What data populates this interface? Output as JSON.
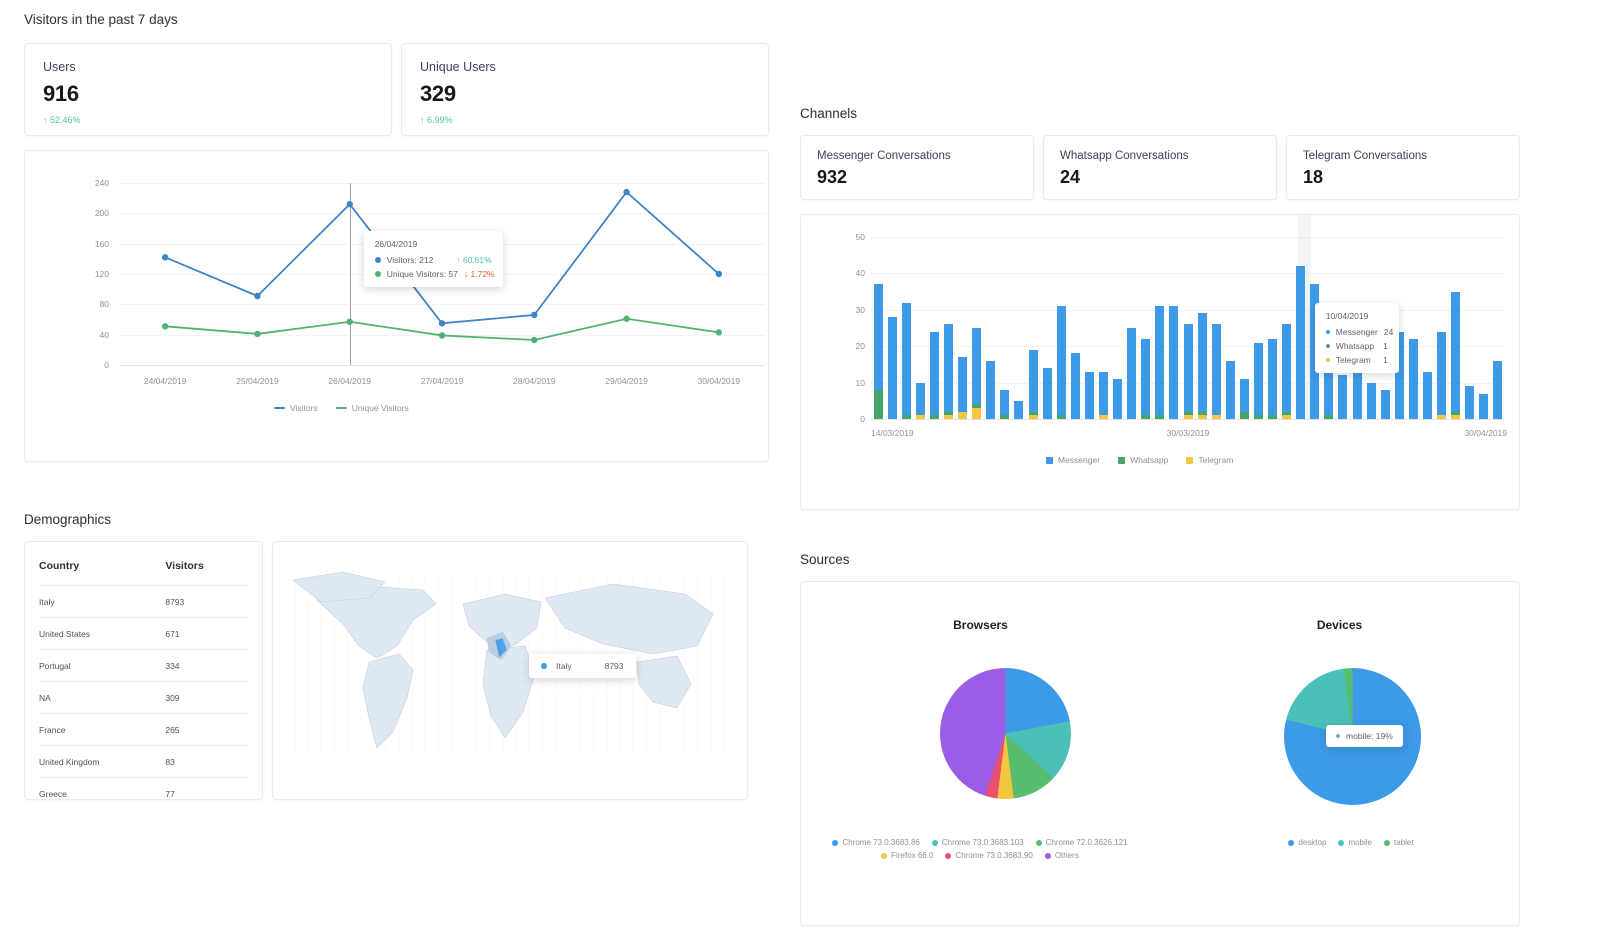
{
  "visitors": {
    "section_title": "Visitors in the past 7 days",
    "kpis": [
      {
        "label": "Users",
        "value": "916",
        "delta": "52.46%",
        "arrow": "↑",
        "direction": "up"
      },
      {
        "label": "Unique Users",
        "value": "329",
        "delta": "6.99%",
        "arrow": "↑",
        "direction": "up"
      }
    ]
  },
  "channels": {
    "section_title": "Channels",
    "cards": [
      {
        "label": "Messenger Conversations",
        "value": "932"
      },
      {
        "label": "Whatsapp Conversations",
        "value": "24"
      },
      {
        "label": "Telegram Conversations",
        "value": "18"
      }
    ]
  },
  "demographics": {
    "section_title": "Demographics",
    "columns": [
      "Country",
      "Visitors"
    ],
    "rows": [
      {
        "country": "Italy",
        "visitors": "8793"
      },
      {
        "country": "United States",
        "visitors": "671"
      },
      {
        "country": "Portugal",
        "visitors": "334"
      },
      {
        "country": "NA",
        "visitors": "309"
      },
      {
        "country": "France",
        "visitors": "265"
      },
      {
        "country": "United Kingdom",
        "visitors": "83"
      },
      {
        "country": "Greece",
        "visitors": "77"
      }
    ],
    "map_tooltip": {
      "label": "Italy",
      "value": "8793"
    }
  },
  "sources": {
    "section_title": "Sources"
  },
  "chart_data": [
    {
      "type": "line",
      "title": "Visitors in the past 7 days",
      "categories": [
        "24/04/2019",
        "25/04/2019",
        "26/04/2019",
        "27/04/2019",
        "28/04/2019",
        "29/04/2019",
        "30/04/2019"
      ],
      "series": [
        {
          "name": "Visitors",
          "color": "#3d85c6",
          "values": [
            142,
            91,
            212,
            55,
            66,
            228,
            120
          ]
        },
        {
          "name": "Unique Visitors",
          "color": "#52b370",
          "values": [
            51,
            41,
            57,
            39,
            33,
            61,
            43
          ]
        }
      ],
      "yticks": [
        0,
        40,
        80,
        120,
        160,
        200,
        240
      ],
      "ylim": [
        0,
        240
      ],
      "grid": true,
      "legend_position": "bottom",
      "tooltip": {
        "title": "26/04/2019",
        "rows": [
          {
            "label": "Visitors: 212",
            "delta": "60.61%",
            "arrow": "↑",
            "direction": "up",
            "color": "#3d85c6"
          },
          {
            "label": "Unique Visitors: 57",
            "delta": "1.72%",
            "arrow": "↓",
            "direction": "down",
            "color": "#52b370"
          }
        ]
      }
    },
    {
      "type": "bar",
      "title": "Channels",
      "stacked": true,
      "xlabels": [
        "14/03/2019",
        "30/03/2019",
        "30/04/2019"
      ],
      "yticks": [
        0,
        10,
        20,
        30,
        40,
        50
      ],
      "ylim": [
        0,
        50
      ],
      "legend_position": "bottom",
      "series": [
        {
          "name": "Messenger",
          "color": "#3d9ae8",
          "values": [
            29,
            28,
            31,
            9,
            23,
            24,
            15,
            21,
            16,
            7,
            5,
            17,
            14,
            30,
            18,
            13,
            12,
            11,
            25,
            21,
            30,
            31,
            24,
            27,
            25,
            16,
            9,
            20,
            21,
            24,
            42,
            37,
            24,
            12,
            23,
            10,
            8,
            24,
            22,
            13,
            23,
            33,
            9,
            7,
            16
          ]
        },
        {
          "name": "Whatsapp",
          "color": "#45a567",
          "values": [
            8,
            0,
            1,
            0,
            1,
            1,
            0,
            1,
            0,
            1,
            0,
            1,
            0,
            1,
            0,
            0,
            0,
            0,
            0,
            1,
            1,
            0,
            1,
            1,
            0,
            0,
            2,
            1,
            1,
            1,
            0,
            0,
            1,
            0,
            0,
            0,
            0,
            0,
            0,
            0,
            0,
            1,
            0,
            0,
            0
          ]
        },
        {
          "name": "Telegram",
          "color": "#f3c63f",
          "values": [
            0,
            0,
            0,
            1,
            0,
            1,
            2,
            3,
            0,
            0,
            0,
            1,
            0,
            0,
            0,
            0,
            1,
            0,
            0,
            0,
            0,
            0,
            1,
            1,
            1,
            0,
            0,
            0,
            0,
            1,
            0,
            0,
            0,
            0,
            0,
            0,
            0,
            0,
            0,
            0,
            1,
            1,
            0,
            0,
            0
          ]
        }
      ],
      "tooltip": {
        "title": "10/04/2019",
        "rows": [
          {
            "label": "Messenger",
            "value": "24",
            "color": "#3d9ae8"
          },
          {
            "label": "Whatsapp",
            "value": "1",
            "color": "#45a567"
          },
          {
            "label": "Telegram",
            "value": "1",
            "color": "#f3c63f"
          }
        ]
      }
    },
    {
      "type": "pie",
      "title": "Browsers",
      "labels": [
        "Chrome 73.0.3683.86",
        "Chrome 73.0.3683.103",
        "Chrome 72.0.3626.121",
        "Firefox 66.0",
        "Chrome 73.0.3683.90",
        "Others"
      ],
      "colors": [
        "#3d9ae8",
        "#4ac0b8",
        "#59bd6f",
        "#f3c63f",
        "#e8506e",
        "#9b5de5"
      ],
      "values": [
        22,
        15,
        11,
        4,
        3,
        45
      ],
      "legend_position": "bottom"
    },
    {
      "type": "pie",
      "title": "Devices",
      "labels": [
        "desktop",
        "mobile",
        "tablet"
      ],
      "colors": [
        "#3d9ae8",
        "#4ac0b8",
        "#59bd6f"
      ],
      "values": [
        79,
        19,
        2
      ],
      "legend_position": "bottom",
      "tooltip": {
        "label": "mobile: 19%",
        "color": "#4ac0b8"
      }
    }
  ]
}
